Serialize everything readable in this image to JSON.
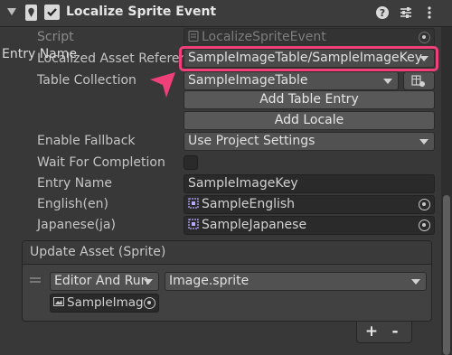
{
  "header": {
    "title": "Localize Sprite Event",
    "enabled": true
  },
  "script": {
    "label": "Script",
    "value": "LocalizeSpriteEvent"
  },
  "overlay": {
    "entry_name_label": "Entry Name"
  },
  "localized_asset_reference": {
    "label": "Localized Asset Reference",
    "value": "SampleImageTable/SampleImageKey"
  },
  "table_collection": {
    "label": "Table Collection",
    "value": "SampleImageTable"
  },
  "buttons": {
    "add_table_entry": "Add Table Entry",
    "add_locale": "Add Locale"
  },
  "enable_fallback": {
    "label": "Enable Fallback",
    "value": "Use Project Settings"
  },
  "wait_for_completion": {
    "label": "Wait For Completion",
    "checked": false
  },
  "entry_name": {
    "label": "Entry Name",
    "value": "SampleImageKey"
  },
  "locales": [
    {
      "label": "English(en)",
      "value": "SampleEnglish"
    },
    {
      "label": "Japanese(ja)",
      "value": "SampleJapanese"
    }
  ],
  "update_asset": {
    "title": "Update Asset (Sprite)",
    "runtime": "Editor And Run",
    "function": "Image.sprite",
    "object": "SampleImag"
  },
  "list_controls": {
    "add": "+",
    "remove": "-"
  },
  "colors": {
    "highlight": "#f0407a",
    "background": "#383838"
  }
}
